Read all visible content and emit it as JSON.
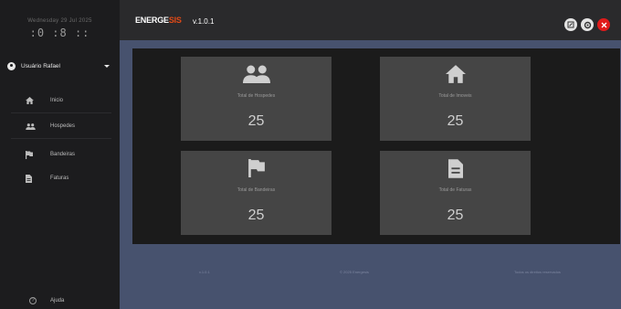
{
  "sidebar": {
    "date": "Wednesday 29 Jul 2025",
    "clock": ":0 :8 ::",
    "user": "Usuário Rafael",
    "items": [
      {
        "label": "Inicio",
        "icon": "home-icon"
      },
      {
        "label": "Hospedes",
        "icon": "people-icon"
      },
      {
        "label": "Bandeiras",
        "icon": "flag-icon"
      },
      {
        "label": "Faturas",
        "icon": "document-icon"
      }
    ],
    "help_label": "Ajuda"
  },
  "header": {
    "logo_left": "ENERGE",
    "logo_accent": "SIS",
    "version": "v.1.0.1",
    "buttons": [
      "edit-icon",
      "settings-icon",
      "close-icon"
    ]
  },
  "cards": [
    {
      "label": "Total de Hospedes",
      "value": "25",
      "icon": "people-icon"
    },
    {
      "label": "Total de Imoveis",
      "value": "25",
      "icon": "home-icon"
    },
    {
      "label": "Total de Bandeiras",
      "value": "25",
      "icon": "flag-icon"
    },
    {
      "label": "Total de Faturas",
      "value": "25",
      "icon": "document-icon"
    }
  ],
  "footer": {
    "left": "v.1.0.1",
    "center": "© 2025 Energesis",
    "right": "Todos os direitos reservados"
  },
  "colors": {
    "accent": "#e04a17",
    "background": "#47526e",
    "sidebar": "#1c1c1e",
    "topbar": "#2a2a2c",
    "card": "#454545",
    "close": "#e01b1b"
  }
}
